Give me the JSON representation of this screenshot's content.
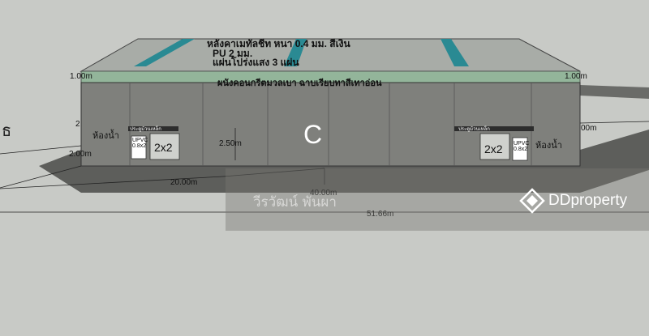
{
  "roof": {
    "line1": "หลังคาเมทัลชีท หนา 0.4 มม. สีเงิน",
    "line2": "PU 2 มม.",
    "line3": "แผ่นโปร่งแสง 3 แผ่น"
  },
  "wall_text": "ผนังคอนกรีตมวลเบา ฉาบเรียบทาสีเทาอ่อน",
  "center_letter": "C",
  "dims": {
    "d_1m_left": "1.00m",
    "d_1m_right": "1.00m",
    "d_2_left": "2",
    "d_2m_left": "2.00m",
    "d_height": "2.50m",
    "d_20m": "20.00m",
    "d_40m": "40.00m",
    "d_5166m": "51.66m",
    "d_00m_right": "00m"
  },
  "left_bay": {
    "room_label": "ห้องน้ำ",
    "upvc_label": "UPVC\n0.8x2",
    "door_size": "2x2",
    "sign": "ประตูม้วนเหล็ก"
  },
  "right_bay": {
    "room_label": "ห้องน้ำ",
    "upvc_label": "UPVC\n0.8x2",
    "door_size": "2x2",
    "sign": "ประตูม้วนเหล็ก"
  },
  "watermark": {
    "name": "วีรวัฒน์ พันผา",
    "brand": "DDproperty",
    "logo_icon": "ddproperty-diamond-icon"
  },
  "colors": {
    "background": "#c8cac6",
    "wall": "#7f807c",
    "roof": "#a7aba6",
    "skylight": "#2a8a93",
    "ground_shadow": "#5d5e5b"
  }
}
